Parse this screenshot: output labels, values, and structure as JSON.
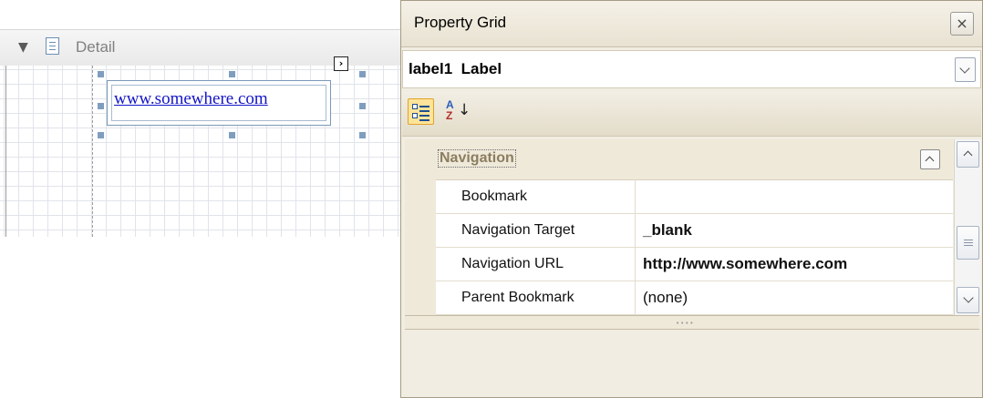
{
  "designer": {
    "band": {
      "title": "Detail",
      "toggle_glyph": "▼"
    },
    "label_control": {
      "text": "www.somewhere.com"
    },
    "smart_tag_glyph": "›"
  },
  "property_grid": {
    "title": "Property Grid",
    "close_glyph": "×",
    "selected_object": "label1  Label",
    "toolbar": {
      "categorized_icon": "categorized-view-icon",
      "alphabetical_icon": "sort-az-icon"
    },
    "category": {
      "label": "Navigation"
    },
    "properties": [
      {
        "name": "Bookmark",
        "value": ""
      },
      {
        "name": "Navigation Target",
        "value": "_blank"
      },
      {
        "name": "Navigation URL",
        "value": "http://www.somewhere.com"
      },
      {
        "name": "Parent Bookmark",
        "value": "(none)"
      }
    ],
    "splitter_glyph": "••••"
  },
  "colors": {
    "link": "#1515c8",
    "panel_bg": "#f1ede2",
    "category_bg": "#efe9da",
    "selected_tool_bg": "#ffe49a"
  }
}
